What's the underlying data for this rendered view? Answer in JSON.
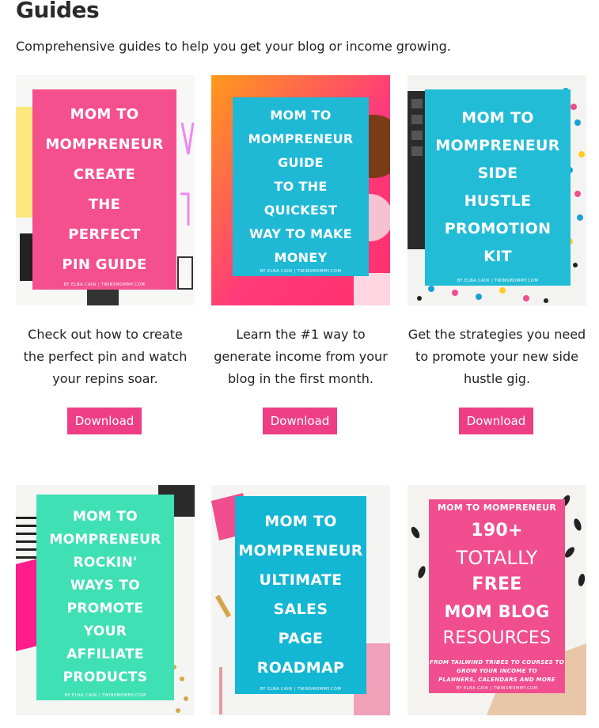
{
  "page": {
    "title": "Guides",
    "subtitle": "Comprehensive guides to help you get your blog or income growing."
  },
  "guides": [
    {
      "cover_lines": [
        "MOM TO",
        "MOMPRENEUR",
        "CREATE",
        "THE",
        "PERFECT",
        "PIN GUIDE"
      ],
      "credit": "BY ELNA CAIN | TWINSMOMMY.COM",
      "description": "Check out how to create the perfect pin and watch your repins soar.",
      "button": "Download",
      "panel_color": "#f5508e"
    },
    {
      "cover_lines": [
        "MOM TO",
        "MOMPRENEUR",
        "GUIDE",
        "TO THE",
        "QUICKEST",
        "WAY TO MAKE",
        "MONEY"
      ],
      "credit": "BY ELNA CAIN | TWINSMOMMY.COM",
      "description": "Learn the #1 way to generate income from your blog in the first month.",
      "button": "Download",
      "panel_color": "#1fb9d6"
    },
    {
      "cover_lines": [
        "MOM TO",
        "MOMPRENEUR",
        "SIDE",
        "HUSTLE",
        "PROMOTION",
        "KIT"
      ],
      "credit": "BY ELNA CAIN | TWINSMOMMY.COM",
      "description": "Get the strategies you need to promote your new side hustle gig.",
      "button": "Download",
      "panel_color": "#23bcd6"
    },
    {
      "cover_lines": [
        "MOM TO",
        "MOMPRENEUR",
        "ROCKIN'",
        "WAYS TO",
        "PROMOTE",
        "YOUR",
        "AFFILIATE",
        "PRODUCTS"
      ],
      "credit": "BY ELNA CAIN | TWINSMOMMY.COM",
      "panel_color": "#3fe0b4"
    },
    {
      "cover_lines": [
        "MOM TO",
        "MOMPRENEUR",
        "ULTIMATE",
        "SALES",
        "PAGE",
        "ROADMAP"
      ],
      "credit": "BY ELNA CAIN | TWINSMOMMY.COM",
      "panel_color": "#13b6d3"
    },
    {
      "cover_top": "MOM TO MOMPRENEUR",
      "cover_lines": [
        "190+",
        "TOTALLY",
        "FREE",
        "MOM BLOG",
        "RESOURCES"
      ],
      "cover_sub": [
        "FROM TAILWIND TRIBES TO COURSES TO",
        "GROW YOUR INCOME TO",
        "PLANNERS, CALENDARS AND MORE"
      ],
      "credit": "BY ELNA CAIN | TWINSMOMMY.COM",
      "panel_color": "#f04e8e"
    }
  ]
}
